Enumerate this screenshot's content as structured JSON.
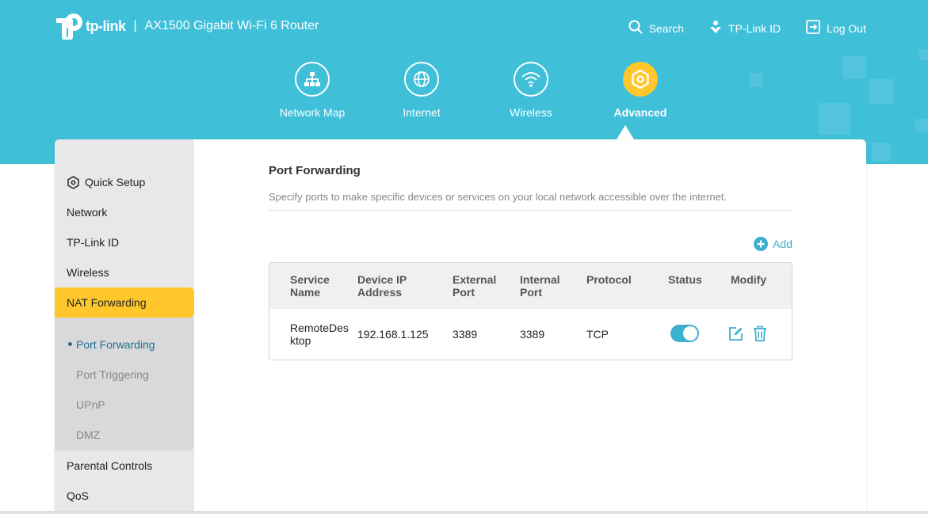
{
  "brand": {
    "logo_text": "tp-link",
    "separator": "|",
    "model": "AX1500 Gigabit Wi-Fi 6 Router"
  },
  "top_actions": {
    "search": "Search",
    "tplink_id": "TP-Link ID",
    "logout": "Log Out"
  },
  "nav": [
    {
      "label": "Network Map",
      "icon": "network-map-icon"
    },
    {
      "label": "Internet",
      "icon": "globe-icon"
    },
    {
      "label": "Wireless",
      "icon": "wifi-icon"
    },
    {
      "label": "Advanced",
      "icon": "gear-icon",
      "active": true
    }
  ],
  "sidebar": {
    "items": [
      {
        "label": "Quick Setup"
      },
      {
        "label": "Network"
      },
      {
        "label": "TP-Link ID"
      },
      {
        "label": "Wireless"
      },
      {
        "label": "NAT Forwarding",
        "active": true
      },
      {
        "label": "Parental Controls"
      },
      {
        "label": "QoS"
      }
    ],
    "sub_items": [
      {
        "label": "Port Forwarding",
        "active": true
      },
      {
        "label": "Port Triggering"
      },
      {
        "label": "UPnP"
      },
      {
        "label": "DMZ"
      }
    ]
  },
  "main": {
    "title": "Port Forwarding",
    "description": "Specify ports to make specific devices or services on your local network accessible over the internet.",
    "add_label": "Add",
    "table": {
      "headers": {
        "service_name": [
          "Service",
          "Name"
        ],
        "device_ip": [
          "Device IP",
          "Address"
        ],
        "external_port": [
          "External",
          "Port"
        ],
        "internal_port": [
          "Internal",
          "Port"
        ],
        "protocol": "Protocol",
        "status": "Status",
        "modify": "Modify"
      },
      "rows": [
        {
          "service_name": [
            "RemoteDes",
            "ktop"
          ],
          "device_ip": "192.168.1.125",
          "external_port": "3389",
          "internal_port": "3389",
          "protocol": "TCP",
          "status_enabled": true
        }
      ]
    }
  },
  "colors": {
    "header_bg": "#3fbfd8",
    "accent_yellow": "#ffc72c",
    "accent_blue": "#3cb0cf",
    "sidebar_bg": "#e8e8ea",
    "sub_bg": "#d9d9dc"
  }
}
